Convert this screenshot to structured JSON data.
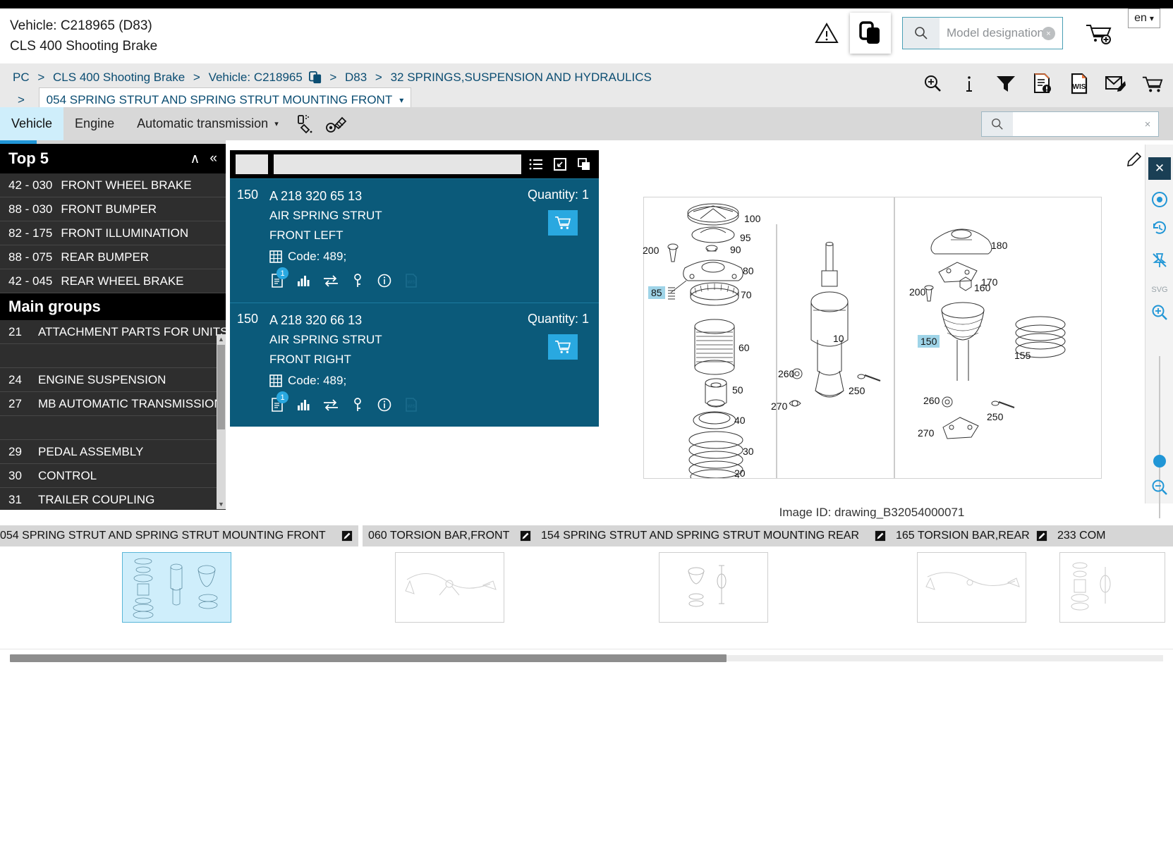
{
  "header": {
    "vehicle_line1": "Vehicle: C218965 (D83)",
    "vehicle_line2": "CLS 400 Shooting Brake",
    "search_placeholder": "Model designation",
    "search_value": "",
    "clear_symbol": "×",
    "language": "en",
    "lang_caret": "▾"
  },
  "breadcrumb": {
    "items": [
      "PC",
      "CLS 400 Shooting Brake",
      "Vehicle: C218965",
      "D83",
      "32 SPRINGS,SUSPENSION AND HYDRAULICS"
    ],
    "separator": ">",
    "current": "054 SPRING STRUT AND SPRING STRUT MOUNTING FRONT",
    "current_caret": "▾",
    "tools": [
      "zoom-in-icon",
      "info-icon",
      "filter-icon",
      "document-alert-icon",
      "wis-document-icon",
      "mail-edit-icon",
      "cart-icon"
    ]
  },
  "tabs": {
    "items": [
      {
        "label": "Vehicle",
        "active": true,
        "caret": ""
      },
      {
        "label": "Engine",
        "active": false,
        "caret": ""
      },
      {
        "label": "Automatic transmission",
        "active": false,
        "caret": "▾"
      }
    ],
    "icons": [
      "paint-spray-icon",
      "bolt-wheel-icon"
    ],
    "search_value": "",
    "clear_symbol": "×"
  },
  "sidebar": {
    "top5_title": "Top 5",
    "collapse_up": "∧",
    "collapse_left": "«",
    "top5_items": [
      {
        "num": "42 - 030",
        "title": "FRONT WHEEL BRAKE"
      },
      {
        "num": "88 - 030",
        "title": "FRONT BUMPER"
      },
      {
        "num": "82 - 175",
        "title": "FRONT ILLUMINATION"
      },
      {
        "num": "88 - 075",
        "title": "REAR BUMPER"
      },
      {
        "num": "42 - 045",
        "title": "REAR WHEEL BRAKE"
      }
    ],
    "main_groups_title": "Main groups",
    "main_groups": [
      {
        "num": "21",
        "title": "ATTACHMENT PARTS FOR UNITS"
      },
      {
        "num": "",
        "title": ""
      },
      {
        "num": "24",
        "title": "ENGINE SUSPENSION"
      },
      {
        "num": "27",
        "title": "MB AUTOMATIC TRANSMISSION"
      },
      {
        "num": "",
        "title": ""
      },
      {
        "num": "29",
        "title": "PEDAL ASSEMBLY"
      },
      {
        "num": "30",
        "title": "CONTROL"
      },
      {
        "num": "31",
        "title": "TRAILER COUPLING"
      }
    ]
  },
  "parts": {
    "toolbar_icons": [
      "list-view-icon",
      "expand-icon",
      "duplicate-icon"
    ],
    "filter_value": "",
    "items": [
      {
        "pos": "150",
        "part_number": "A 218 320 65 13",
        "description": "AIR SPRING STRUT",
        "side": "FRONT LEFT",
        "code": "Code: 489;",
        "quantity_label": "Quantity: 1",
        "badge": "1",
        "row_icons": [
          "note-document-icon",
          "chart-icon",
          "exchange-icon",
          "key-icon",
          "info-circle-icon",
          "wis-icon"
        ]
      },
      {
        "pos": "150",
        "part_number": "A 218 320 66 13",
        "description": "AIR SPRING STRUT",
        "side": "FRONT RIGHT",
        "code": "Code: 489;",
        "quantity_label": "Quantity: 1",
        "badge": "1",
        "row_icons": [
          "note-document-icon",
          "chart-icon",
          "exchange-icon",
          "key-icon",
          "info-circle-icon",
          "wis-icon"
        ]
      }
    ]
  },
  "drawing": {
    "image_id": "Image ID: drawing_B32054000071",
    "callouts_left": [
      "100",
      "95",
      "200",
      "90",
      "80",
      "85",
      "70",
      "60",
      "50",
      "40",
      "30",
      "20"
    ],
    "callouts_mid": [
      "10",
      "260",
      "250",
      "270"
    ],
    "callouts_right": [
      "180",
      "170",
      "200",
      "160",
      "150",
      "155",
      "260",
      "250",
      "270"
    ],
    "highlighted_callouts": [
      "85",
      "150"
    ],
    "vtool_icons": [
      "close-icon",
      "target-icon",
      "history-icon",
      "unpin-icon",
      "svg-icon",
      "zoom-in-icon",
      "zoom-out-icon"
    ],
    "edit_icon": "edit-icon"
  },
  "thumbnails": [
    {
      "label": "054 SPRING STRUT AND SPRING STRUT MOUNTING FRONT",
      "selected": true
    },
    {
      "label": "060 TORSION BAR,FRONT",
      "selected": false
    },
    {
      "label": "154 SPRING STRUT AND SPRING STRUT MOUNTING REAR",
      "selected": false
    },
    {
      "label": "165 TORSION BAR,REAR",
      "selected": false
    },
    {
      "label": "233 COM",
      "selected": false
    }
  ]
}
